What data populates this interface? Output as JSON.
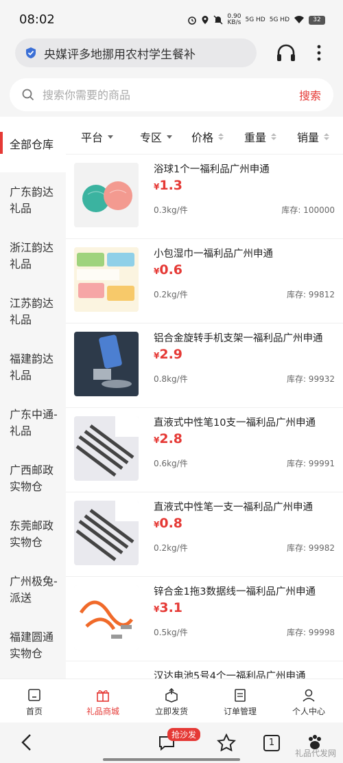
{
  "status": {
    "time": "08:02",
    "net_speed": "0.90",
    "net_unit": "KB/s",
    "sig1": "5G HD",
    "sig2": "5G HD",
    "battery": "32"
  },
  "header": {
    "url_text": "央媒评多地挪用农村学生餐补"
  },
  "search": {
    "placeholder": "搜索你需要的商品",
    "button": "搜索"
  },
  "sidebar": {
    "items": [
      {
        "label": "全部仓库",
        "active": true
      },
      {
        "label": "广东韵达礼品"
      },
      {
        "label": "浙江韵达礼品"
      },
      {
        "label": "江苏韵达礼品"
      },
      {
        "label": "福建韵达礼品"
      },
      {
        "label": "广东中通-礼品"
      },
      {
        "label": "广西邮政实物仓"
      },
      {
        "label": "东莞邮政实物仓"
      },
      {
        "label": "广州极兔-派送"
      },
      {
        "label": "福建圆通实物仓"
      }
    ]
  },
  "sort": {
    "platform": "平台",
    "zone": "专区",
    "price": "价格",
    "weight": "重量",
    "sales": "销量"
  },
  "products": [
    {
      "name": "浴球1个一福利品广州申通",
      "currency": "¥",
      "price": "1.3",
      "weight": "0.3kg/件",
      "stock": "库存: 100000"
    },
    {
      "name": "小包湿巾一福利品广州申通",
      "currency": "¥",
      "price": "0.6",
      "weight": "0.2kg/件",
      "stock": "库存: 99812"
    },
    {
      "name": "铝合金旋转手机支架一福利品广州申通",
      "currency": "¥",
      "price": "2.9",
      "weight": "0.8kg/件",
      "stock": "库存: 99932"
    },
    {
      "name": "直液式中性笔10支一福利品广州申通",
      "currency": "¥",
      "price": "2.8",
      "weight": "0.6kg/件",
      "stock": "库存: 99991"
    },
    {
      "name": "直液式中性笔一支一福利品广州申通",
      "currency": "¥",
      "price": "0.8",
      "weight": "0.2kg/件",
      "stock": "库存: 99982"
    },
    {
      "name": "锌合金1拖3数据线一福利品广州申通",
      "currency": "¥",
      "price": "3.1",
      "weight": "0.5kg/件",
      "stock": "库存: 99998"
    },
    {
      "name": "汉达电池5号4个一福利品广州申通",
      "currency": "",
      "price": "",
      "weight": "",
      "stock": ""
    }
  ],
  "tabs": [
    {
      "label": "首页"
    },
    {
      "label": "礼品商城",
      "active": true
    },
    {
      "label": "立即发货"
    },
    {
      "label": "订单管理"
    },
    {
      "label": "个人中心"
    }
  ],
  "sysnav": {
    "badge": "抢沙发",
    "tab_count": "1",
    "watermark": "礼品代发网"
  },
  "colors": {
    "accent": "#e53935",
    "sidebar_bg": "#f6f6f6"
  }
}
